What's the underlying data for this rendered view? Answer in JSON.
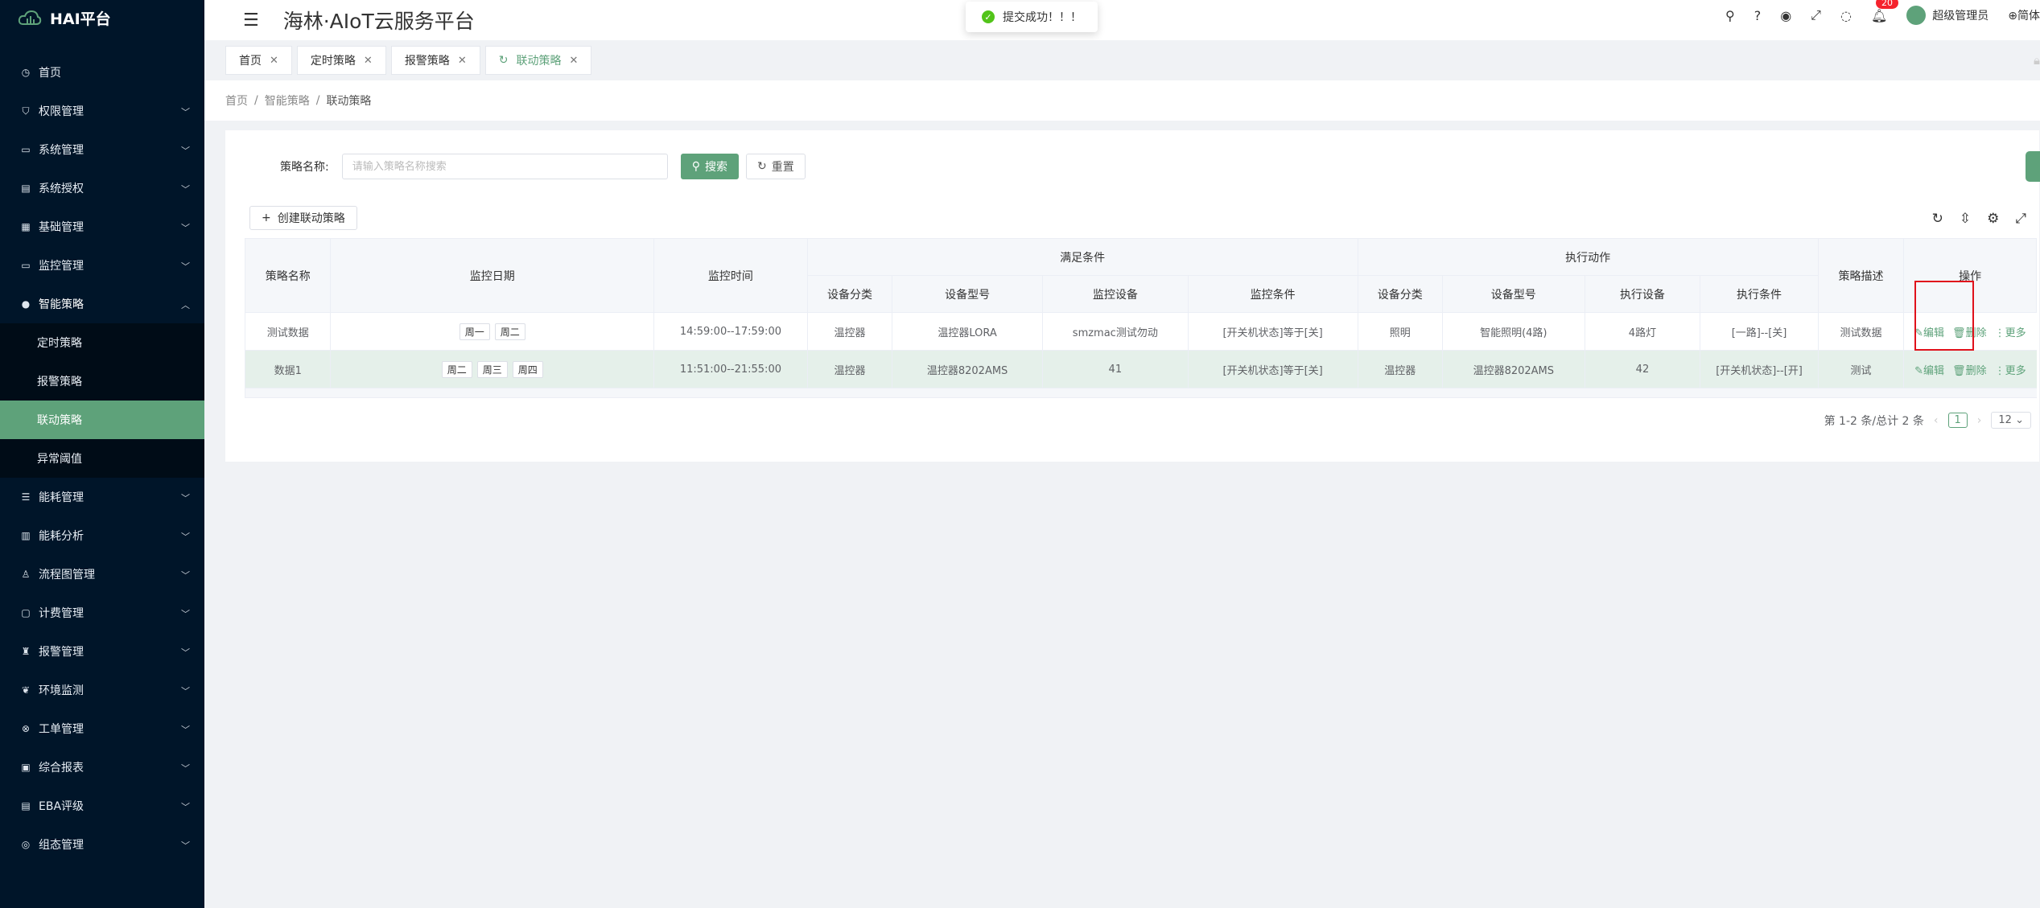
{
  "app": {
    "logo": "HAI平台",
    "title": "海林·AIoT云服务平台"
  },
  "toast": {
    "message": "提交成功！！！"
  },
  "header": {
    "notification_count": "20",
    "user_name": "超级管理员",
    "language": "简体"
  },
  "sidebar": {
    "items": [
      {
        "label": "首页",
        "icon": "dashboard-icon"
      },
      {
        "label": "权限管理",
        "icon": "shield-icon"
      },
      {
        "label": "系统管理",
        "icon": "monitor-icon"
      },
      {
        "label": "系统授权",
        "icon": "license-icon"
      },
      {
        "label": "基础管理",
        "icon": "database-icon"
      },
      {
        "label": "监控管理",
        "icon": "monitor-icon"
      },
      {
        "label": "智能策略",
        "icon": "bulb-icon"
      },
      {
        "label": "能耗管理",
        "icon": "sliders-icon"
      },
      {
        "label": "能耗分析",
        "icon": "bar-chart-icon"
      },
      {
        "label": "流程图管理",
        "icon": "flow-icon"
      },
      {
        "label": "计费管理",
        "icon": "billing-icon"
      },
      {
        "label": "报警管理",
        "icon": "alarm-icon"
      },
      {
        "label": "环境监测",
        "icon": "leaf-icon"
      },
      {
        "label": "工单管理",
        "icon": "ticket-icon"
      },
      {
        "label": "综合报表",
        "icon": "report-icon"
      },
      {
        "label": "EBA评级",
        "icon": "rating-icon"
      },
      {
        "label": "组态管理",
        "icon": "config-icon"
      }
    ],
    "submenu": [
      {
        "label": "定时策略"
      },
      {
        "label": "报警策略"
      },
      {
        "label": "联动策略"
      },
      {
        "label": "异常阈值"
      }
    ]
  },
  "tabs": [
    {
      "label": "首页"
    },
    {
      "label": "定时策略"
    },
    {
      "label": "报警策略"
    },
    {
      "label": "联动策略"
    }
  ],
  "breadcrumb": {
    "home": "首页",
    "parent": "智能策略",
    "current": "联动策略"
  },
  "search": {
    "label": "策略名称:",
    "placeholder": "请输入策略名称搜索",
    "search_button": "搜索",
    "reset_button": "重置"
  },
  "toolbar": {
    "create_button": "创建联动策略"
  },
  "table": {
    "headers": {
      "name": "策略名称",
      "date": "监控日期",
      "time": "监控时间",
      "group_condition": "满足条件",
      "group_action": "执行动作",
      "desc": "策略描述",
      "ops": "操作",
      "c_cat": "设备分类",
      "c_model": "设备型号",
      "c_device": "监控设备",
      "c_cond": "监控条件",
      "a_cat": "设备分类",
      "a_model": "设备型号",
      "a_device": "执行设备",
      "a_cond": "执行条件"
    },
    "rows": [
      {
        "name": "测试数据",
        "days": [
          "周一",
          "周二"
        ],
        "time": "14:59:00--17:59:00",
        "c_cat": "温控器",
        "c_model": "温控器LORA",
        "c_device": "smzmac测试勿动",
        "c_cond": "[开关机状态]等于[关]",
        "a_cat": "照明",
        "a_model": "智能照明(4路)",
        "a_device": "4路灯",
        "a_cond": "[一路]--[关]",
        "desc": "测试数据"
      },
      {
        "name": "数据1",
        "days": [
          "周二",
          "周三",
          "周四"
        ],
        "time": "11:51:00--21:55:00",
        "c_cat": "温控器",
        "c_model": "温控器8202AMS",
        "c_device": "41",
        "c_cond": "[开关机状态]等于[关]",
        "a_cat": "温控器",
        "a_model": "温控器8202AMS",
        "a_device": "42",
        "a_cond": "[开关机状态]--[开]",
        "desc": "测试"
      }
    ],
    "ops": {
      "edit": "编辑",
      "delete": "删除",
      "more": "更多"
    }
  },
  "pagination": {
    "summary": "第 1-2 条/总计 2 条",
    "page": "1",
    "page_size": "12"
  }
}
